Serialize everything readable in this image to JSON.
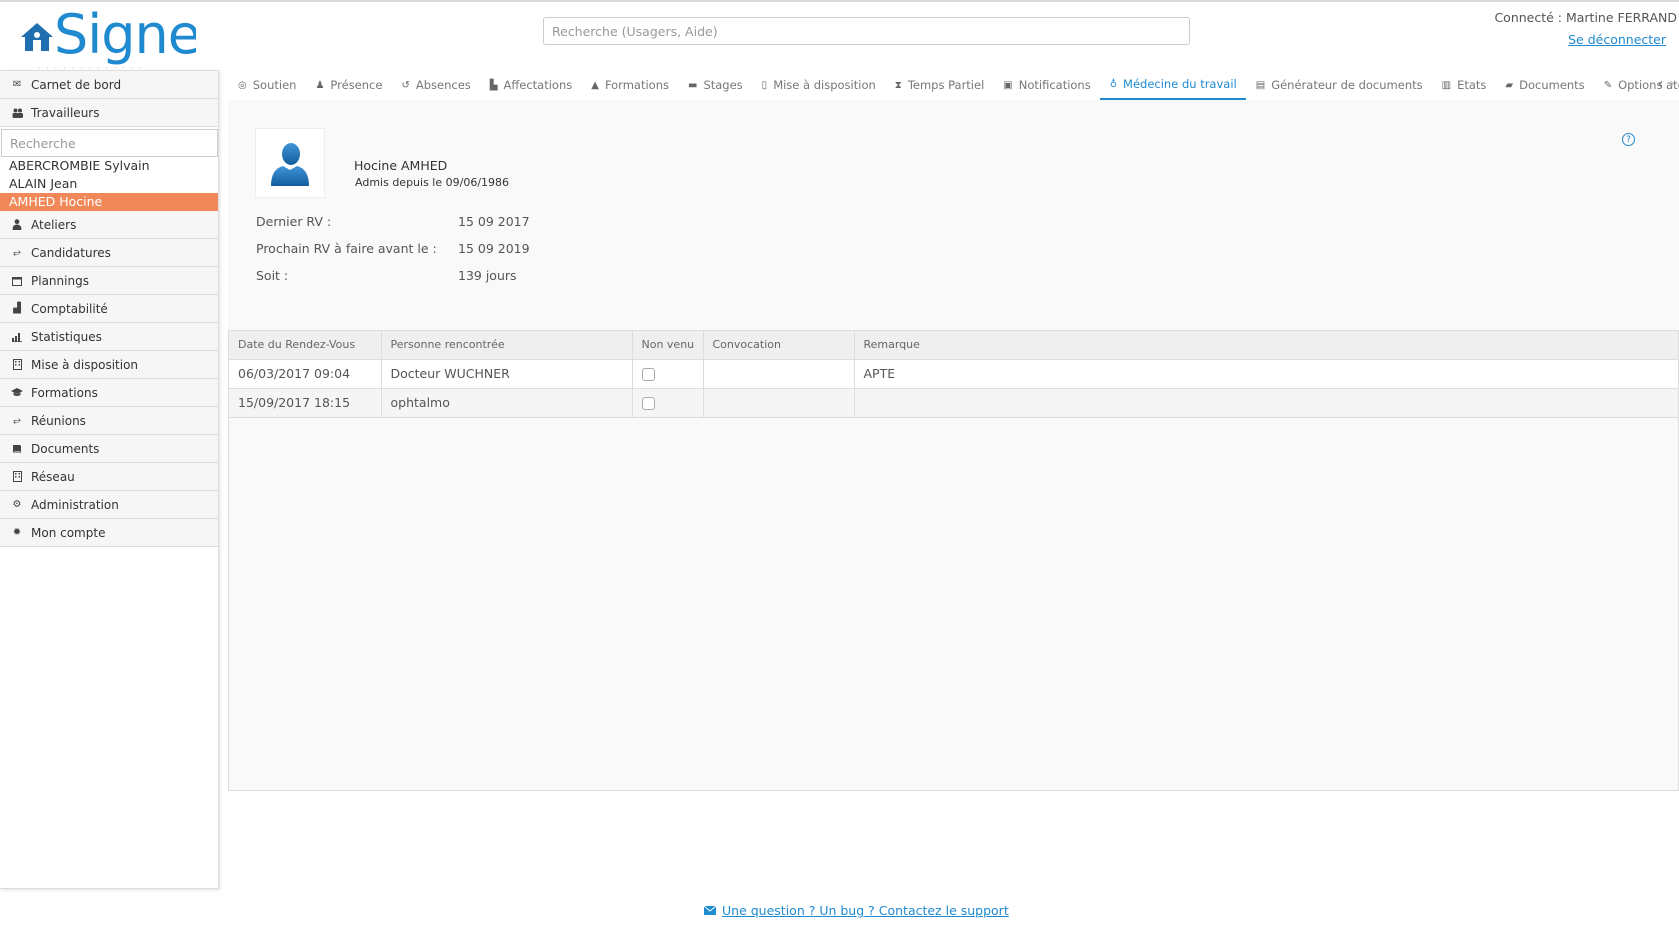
{
  "header": {
    "logo_text": "Signe",
    "logo_tagline": "· · · · · · · · · · · · ·",
    "search_placeholder": "Recherche (Usagers, Aide)",
    "connected_user": "Connecté : Martine FERRAND",
    "logout_label": "Se déconnecter"
  },
  "sidebar": {
    "items_top": [
      {
        "label": "Carnet de bord",
        "icon": "envelope-icon"
      },
      {
        "label": "Travailleurs",
        "icon": "users-icon"
      }
    ],
    "search_placeholder": "Recherche",
    "workers": [
      "ABERCROMBIE Sylvain",
      "ALAIN Jean",
      "AMHED Hocine"
    ],
    "active_worker": "AMHED Hocine",
    "items_bottom": [
      {
        "label": "Ateliers",
        "icon": "person-icon"
      },
      {
        "label": "Candidatures",
        "icon": "handshake-icon"
      },
      {
        "label": "Plannings",
        "icon": "calendar-icon"
      },
      {
        "label": "Comptabilité",
        "icon": "calculator-icon"
      },
      {
        "label": "Statistiques",
        "icon": "bar-chart-icon"
      },
      {
        "label": "Mise à disposition",
        "icon": "building-icon"
      },
      {
        "label": "Formations",
        "icon": "graduation-cap-icon"
      },
      {
        "label": "Réunions",
        "icon": "handshake-icon"
      },
      {
        "label": "Documents",
        "icon": "book-icon"
      },
      {
        "label": "Réseau",
        "icon": "building-icon"
      },
      {
        "label": "Administration",
        "icon": "cogs-icon"
      },
      {
        "label": "Mon compte",
        "icon": "gear-icon"
      }
    ]
  },
  "tabs": [
    {
      "label": "Soutien",
      "icon": "life-ring-icon"
    },
    {
      "label": "Présence",
      "icon": "person-icon"
    },
    {
      "label": "Absences",
      "icon": "history-icon"
    },
    {
      "label": "Affectations",
      "icon": "industry-icon"
    },
    {
      "label": "Formations",
      "icon": "graduation-cap-icon"
    },
    {
      "label": "Stages",
      "icon": "briefcase-icon"
    },
    {
      "label": "Mise à disposition",
      "icon": "building-icon"
    },
    {
      "label": "Temps Partiel",
      "icon": "hourglass-icon"
    },
    {
      "label": "Notifications",
      "icon": "calendar-icon"
    },
    {
      "label": "Médecine du travail",
      "icon": "stethoscope-icon"
    },
    {
      "label": "Générateur de documents",
      "icon": "file-icon"
    },
    {
      "label": "Etats",
      "icon": "file-text-icon"
    },
    {
      "label": "Documents",
      "icon": "book-icon"
    },
    {
      "label": "Options ateliers",
      "icon": "wrench-icon"
    }
  ],
  "active_tab": "Médecine du travail",
  "profile": {
    "name": "Hocine AMHED",
    "admission": "Admis depuis le 09/06/1986"
  },
  "medical": {
    "last_rv_label": "Dernier RV :",
    "last_rv_value": "15 09 2017",
    "next_rv_label": "Prochain RV à faire avant le :",
    "next_rv_value": "15 09 2019",
    "soit_label": "Soit :",
    "soit_value": "139 jours"
  },
  "table": {
    "columns": [
      "Date du Rendez-Vous",
      "Personne rencontrée",
      "Non venu",
      "Convocation",
      "Remarque"
    ],
    "rows": [
      {
        "date": "06/03/2017 09:04",
        "person": "Docteur WUCHNER",
        "no_show": false,
        "convocation": "",
        "remark": "APTE"
      },
      {
        "date": "15/09/2017 18:15",
        "person": "ophtalmo",
        "no_show": false,
        "convocation": "",
        "remark": ""
      }
    ]
  },
  "footer": {
    "support_label": "Une question ? Un bug ? Contactez le support"
  }
}
